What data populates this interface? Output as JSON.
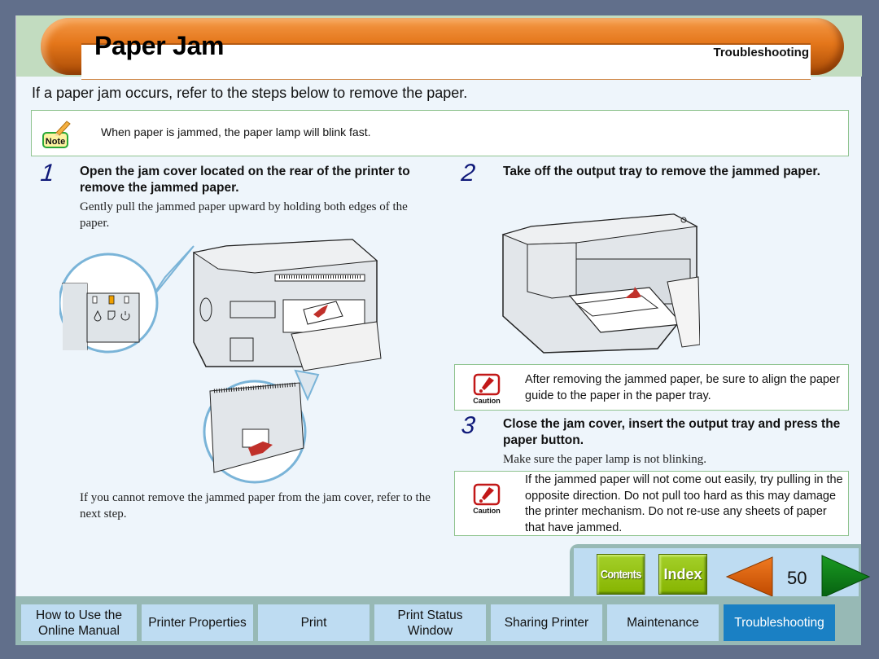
{
  "header": {
    "title": "Paper Jam",
    "section": "Troubleshooting"
  },
  "intro": "If a paper jam occurs, refer to the steps below to remove the paper.",
  "note": {
    "icon": "note-pencil-icon",
    "icon_label": "Note",
    "text": "When paper is jammed, the paper lamp will blink fast."
  },
  "steps": [
    {
      "number": "1",
      "heading": "Open the jam cover located on the rear of the printer to remove the jammed paper.",
      "body": "Gently pull the jammed paper upward by holding both edges of the paper.",
      "footer": "If you cannot remove the jammed paper from the jam cover, refer to the next step."
    },
    {
      "number": "2",
      "heading": "Take off the output tray to remove the jammed paper."
    },
    {
      "number": "3",
      "heading": "Close the jam cover, insert the output tray and press the paper button.",
      "body": "Make sure the paper lamp is not blinking."
    }
  ],
  "cautions": [
    {
      "icon": "caution-icon",
      "icon_label": "Caution",
      "text": "After removing the jammed paper, be sure to align the paper guide to the paper in the paper tray."
    },
    {
      "icon": "caution-icon",
      "icon_label": "Caution",
      "text": "If the jammed paper will not come out easily, try pulling in the opposite direction. Do not pull too hard as this may damage the printer mechanism. Do not re-use any sheets of paper that have jammed."
    }
  ],
  "nav": {
    "contents_label": "Contents",
    "index_label": "Index",
    "page_number": "50",
    "prev_icon": "prev-page-arrow-icon",
    "next_icon": "next-page-arrow-icon"
  },
  "tabs": [
    {
      "label": "How to Use the Online Manual",
      "active": false
    },
    {
      "label": "Printer Properties",
      "active": false
    },
    {
      "label": "Print",
      "active": false
    },
    {
      "label": "Print Status Window",
      "active": false
    },
    {
      "label": "Sharing Printer",
      "active": false
    },
    {
      "label": "Maintenance",
      "active": false
    },
    {
      "label": "Troubleshooting",
      "active": true
    }
  ],
  "colors": {
    "background": "#616f8b",
    "title_pill": "#e4761a",
    "active_tab": "#1a80c4",
    "tab": "#bedcf2",
    "nav_green": "#94c400",
    "prev_arrow": "#e06010",
    "next_arrow": "#0a7a14",
    "step_number": "#101a7a"
  }
}
